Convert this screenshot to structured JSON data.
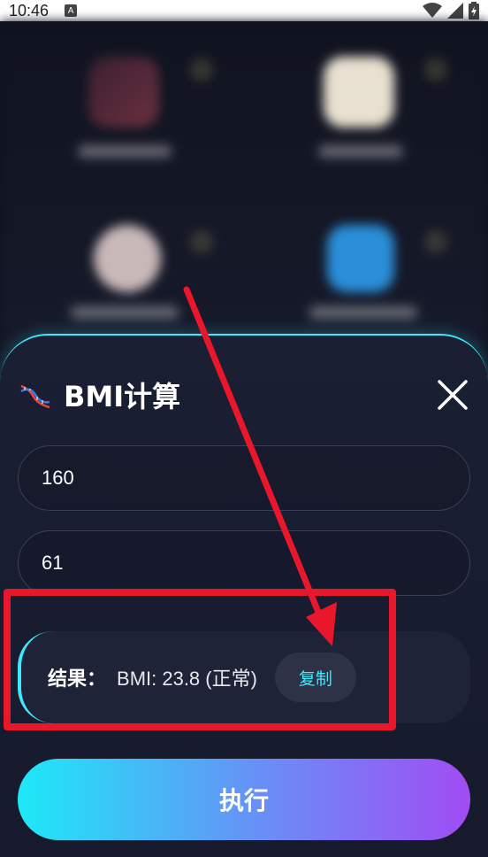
{
  "status_bar": {
    "time": "10:46",
    "notification_glyph": "A"
  },
  "sheet": {
    "title": "BMI计算",
    "height_value": "160",
    "weight_value": "61",
    "result_label": "结果：",
    "result_value": "BMI: 23.8 (正常)",
    "copy_label": "复制",
    "execute_label": "执行"
  },
  "icons": {
    "title_icon": "dna-icon",
    "close_icon": "close-icon",
    "wifi_icon": "wifi-icon",
    "signal_icon": "signal-icon",
    "battery_icon": "battery-icon"
  },
  "colors": {
    "accent_cyan": "#3ee8ff",
    "gradient_start": "#1ee8f7",
    "gradient_end": "#a14cf3",
    "annotation_red": "#e8172c",
    "sheet_background": "#1b1f33"
  }
}
